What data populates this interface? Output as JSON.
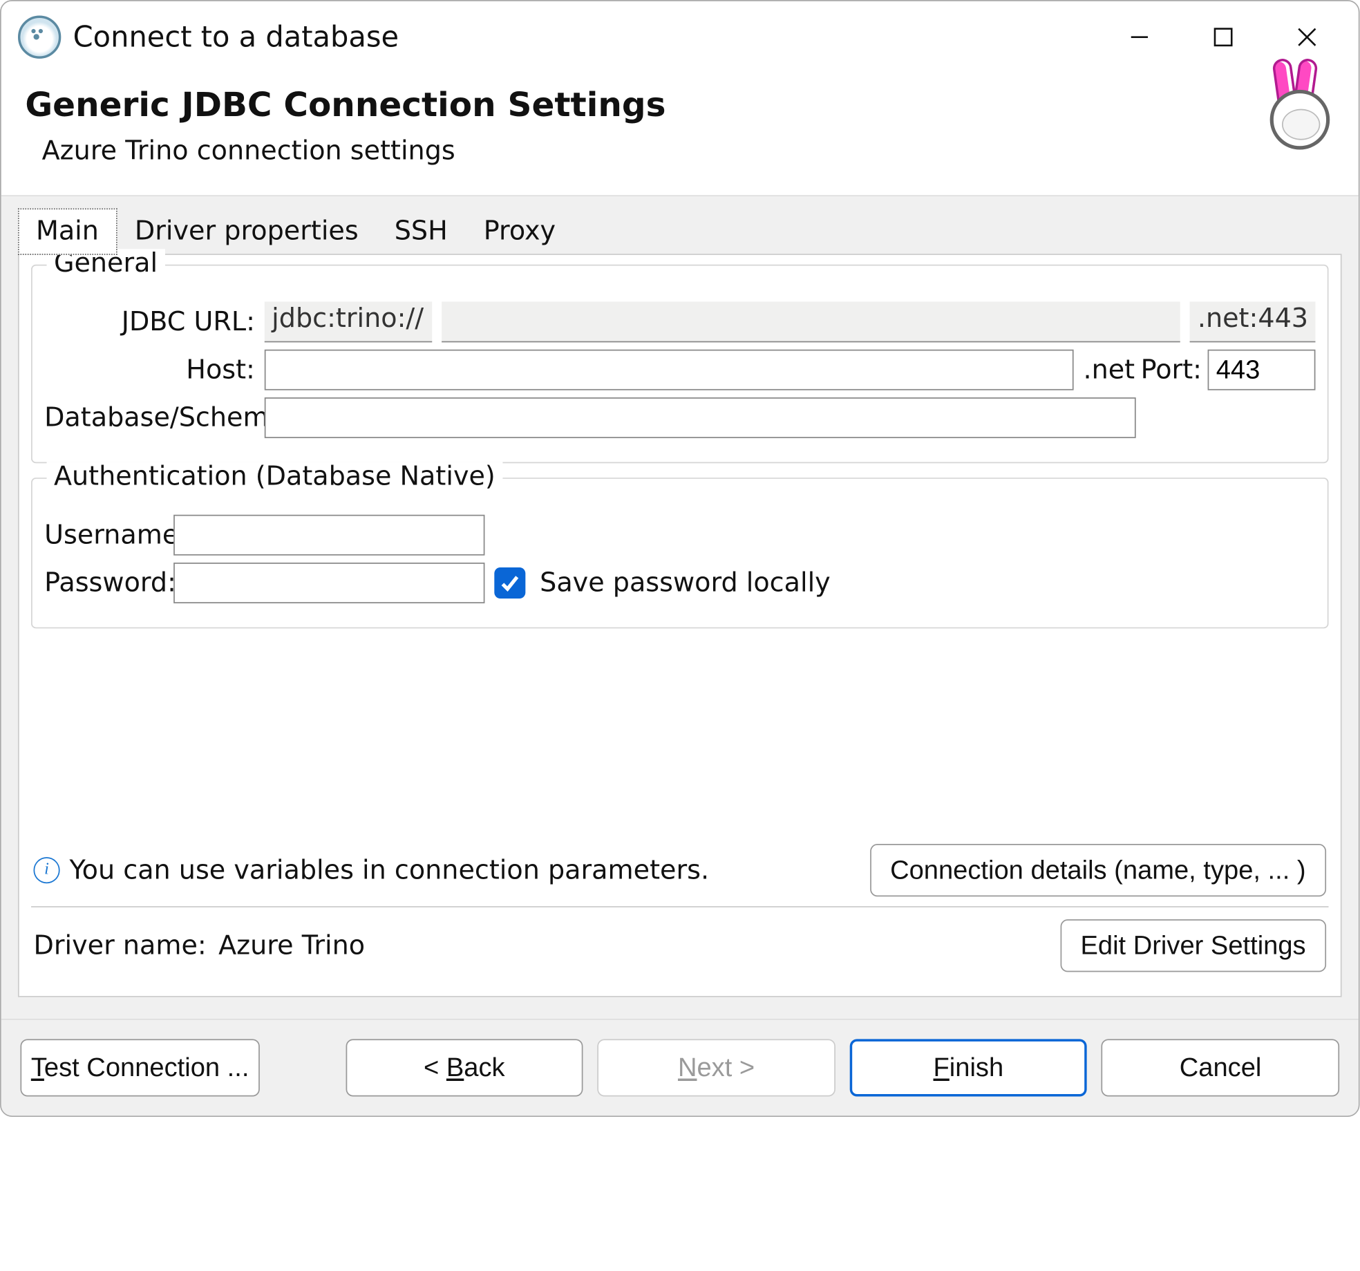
{
  "window": {
    "title": "Connect to a database"
  },
  "header": {
    "title": "Generic JDBC Connection Settings",
    "subtitle": "Azure Trino connection settings"
  },
  "tabs": {
    "main": "Main",
    "driver_props": "Driver properties",
    "ssh": "SSH",
    "proxy": "Proxy"
  },
  "general": {
    "legend": "General",
    "jdbc_url_label": "JDBC URL:",
    "jdbc_url_prefix": "jdbc:trino://",
    "jdbc_url_suffix": ".net:443",
    "host_label": "Host:",
    "host_value": "",
    "host_suffix": ".net",
    "port_label": "Port:",
    "port_value": "443",
    "db_schema_label": "Database/Schema:",
    "db_schema_value": ""
  },
  "auth": {
    "legend": "Authentication (Database Native)",
    "username_label": "Username:",
    "username_value": "",
    "password_label": "Password:",
    "password_value": "",
    "save_pw_checked": true,
    "save_pw_label": "Save password locally"
  },
  "info": {
    "text": "You can use variables in connection parameters.",
    "connection_details_btn": "Connection details (name, type, ... )"
  },
  "driver": {
    "label": "Driver name:",
    "value": "Azure Trino",
    "edit_btn": "Edit Driver Settings"
  },
  "footer": {
    "test": "Test Connection ...",
    "back_prefix": "< ",
    "back_u": "B",
    "back_rest": "ack",
    "next_u": "N",
    "next_rest": "ext >",
    "finish_u": "F",
    "finish_rest": "inish",
    "cancel": "Cancel"
  }
}
